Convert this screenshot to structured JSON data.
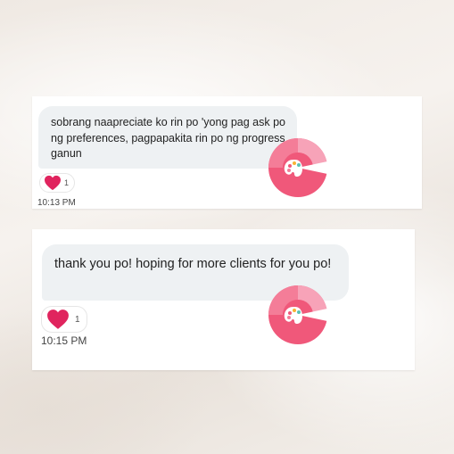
{
  "messages": [
    {
      "text": "sobrang naapreciate ko rin po 'yong pag ask po ng preferences, pagpapakita rin po ng progress ganun",
      "reaction": {
        "icon": "heart-icon",
        "count": "1"
      },
      "time": "10:13 PM"
    },
    {
      "text": "thank you po! hoping for more clients for you po!",
      "reaction": {
        "icon": "heart-icon",
        "count": "1"
      },
      "time": "10:15 PM"
    }
  ],
  "brand": {
    "logo_icon": "palette-logo-icon",
    "colors": {
      "primary": "#f0587a",
      "light": "#f7a3b8",
      "heart": "#e0245e"
    }
  }
}
